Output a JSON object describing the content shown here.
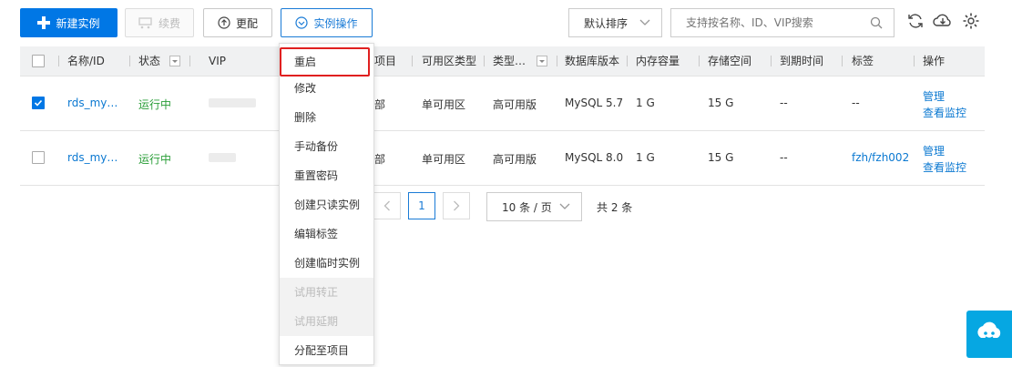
{
  "toolbar": {
    "new_instance": "新建实例",
    "renew": "续费",
    "change_config": "更配",
    "instance_ops": "实例操作",
    "sort_label": "默认排序",
    "search_placeholder": "支持按名称、ID、VIP搜索"
  },
  "table": {
    "headers": {
      "name_id": "名称/ID",
      "status": "状态",
      "vip": "VIP",
      "project": "项目",
      "zone_type": "可用区类型",
      "type": "类型…",
      "db_version": "数据库版本",
      "memory": "内存容量",
      "storage": "存储空间",
      "expire": "到期时间",
      "tags": "标签",
      "ops": "操作"
    },
    "rows": [
      {
        "checked": true,
        "name": "rds_my…",
        "status": "运行中",
        "project": "部",
        "zone_type": "单可用区",
        "type": "高可用版",
        "db_version": "MySQL 5.7",
        "memory": "1 G",
        "storage": "15 G",
        "expire": "--",
        "tags": "--",
        "op_manage": "管理",
        "op_monitor": "查看监控"
      },
      {
        "checked": false,
        "name": "rds_my…",
        "status": "运行中",
        "project": "部",
        "zone_type": "单可用区",
        "type": "高可用版",
        "db_version": "MySQL 8.0",
        "memory": "1 G",
        "storage": "15 G",
        "expire": "--",
        "tags": "fzh/fzh002",
        "op_manage": "管理",
        "op_monitor": "查看监控"
      }
    ]
  },
  "menu": {
    "items": [
      {
        "label": "重启",
        "disabled": false,
        "highlight": true
      },
      {
        "label": "修改",
        "disabled": false
      },
      {
        "label": "删除",
        "disabled": false
      },
      {
        "label": "手动备份",
        "disabled": false
      },
      {
        "label": "重置密码",
        "disabled": false
      },
      {
        "label": "创建只读实例",
        "disabled": false
      },
      {
        "label": "编辑标签",
        "disabled": false
      },
      {
        "label": "创建临时实例",
        "disabled": false
      },
      {
        "label": "试用转正",
        "disabled": true
      },
      {
        "label": "试用延期",
        "disabled": true
      },
      {
        "label": "分配至项目",
        "disabled": false
      }
    ]
  },
  "pagination": {
    "current_page": "1",
    "page_size": "10 条 / 页",
    "total": "共 2 条"
  },
  "colors": {
    "primary": "#0077e5",
    "link": "#0a78d1",
    "running": "#2a9e38",
    "highlight_border": "#e02020",
    "float_button": "#06a7e2"
  }
}
